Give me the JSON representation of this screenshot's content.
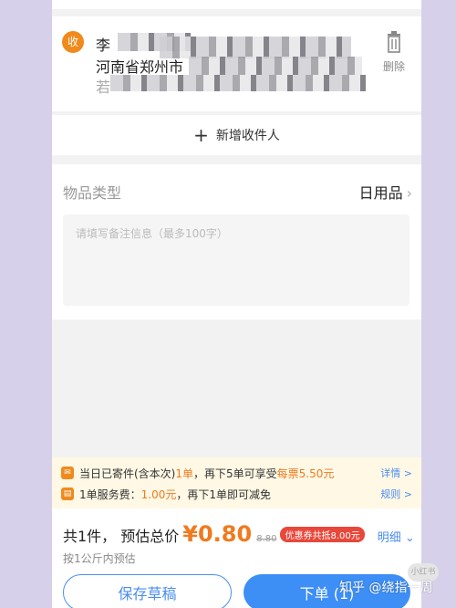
{
  "receiver": {
    "badge": "收",
    "name": "李",
    "address_line": "河南省郑州市",
    "detail_prefix": "若"
  },
  "delete_label": "删除",
  "add_receiver_label": "新增收件人",
  "goods": {
    "label": "物品类型",
    "value": "日用品",
    "note_placeholder": "请填写备注信息（最多100字）"
  },
  "notice": {
    "row1_text": "当日已寄件(含本次)",
    "row1_count": "1单",
    "row1_mid": "，再下5单可享受",
    "row1_highlight": "每票5.50元",
    "row1_link": "详情 >",
    "row2_text": "1单服务费：",
    "row2_fee": "1.00元",
    "row2_rest": "，再下1单即可减免",
    "row2_link": "规则 >"
  },
  "footer": {
    "count_label": "共1件，  预估总价",
    "price": "¥0.80",
    "original_price": "8.80",
    "coupon": "优惠券共抵8.00元",
    "detail_link": "明细",
    "sub_note": "按1公斤内预估",
    "draft_button": "保存草稿",
    "order_button": "下单 (1)"
  },
  "watermark": "知乎 @绕指一周",
  "tiny_badge": "小红书",
  "colors": {
    "accent": "#3d8ef5",
    "orange": "#f07a1e",
    "coupon_red": "#e8483b",
    "notice_bg": "#fff8e5"
  }
}
